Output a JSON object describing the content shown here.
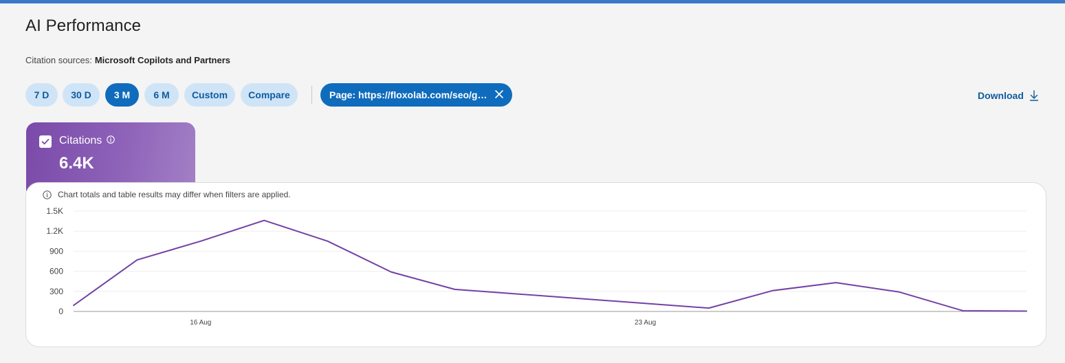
{
  "page": {
    "title": "AI Performance"
  },
  "sources": {
    "label": "Citation sources:",
    "value": "Microsoft Copilots and Partners"
  },
  "ranges": [
    {
      "label": "7 D",
      "active": false
    },
    {
      "label": "30 D",
      "active": false
    },
    {
      "label": "3 M",
      "active": true
    },
    {
      "label": "6 M",
      "active": false
    },
    {
      "label": "Custom",
      "active": false
    },
    {
      "label": "Compare",
      "active": false
    }
  ],
  "filter": {
    "label": "Page: https://floxolab.com/seo/gui..."
  },
  "download": {
    "label": "Download"
  },
  "metric": {
    "label": "Citations",
    "value": "6.4K",
    "checked": true
  },
  "note": {
    "text": "Chart totals and table results may differ when filters are applied."
  },
  "colors": {
    "accent": "#0f6cbd",
    "series": "#7340a6",
    "chip_bg": "#cfe4f7"
  },
  "chart_data": {
    "type": "line",
    "series": [
      {
        "values": [
          {
            "x": "2025-08-14",
            "y": 90
          },
          {
            "x": "2025-08-15",
            "y": 770
          },
          {
            "x": "2025-08-16",
            "y": 1050
          },
          {
            "x": "2025-08-17",
            "y": 1360
          },
          {
            "x": "2025-08-18",
            "y": 1050
          },
          {
            "x": "2025-08-19",
            "y": 590
          },
          {
            "x": "2025-08-20",
            "y": 330
          },
          {
            "x": "2025-08-24",
            "y": 50
          },
          {
            "x": "2025-08-25",
            "y": 310
          },
          {
            "x": "2025-08-26",
            "y": 430
          },
          {
            "x": "2025-08-27",
            "y": 290
          },
          {
            "x": "2025-08-28",
            "y": 10
          },
          {
            "x": "2025-08-29",
            "y": 5
          }
        ]
      }
    ],
    "yticks": [
      "0",
      "300",
      "600",
      "900",
      "1.2K",
      "1.5K"
    ],
    "ylim": [
      0,
      1500
    ],
    "xticks": [
      {
        "x": "2025-08-16",
        "label": "16 Aug"
      },
      {
        "x": "2025-08-23",
        "label": "23 Aug"
      }
    ],
    "xlim": [
      "2025-08-14",
      "2025-08-29"
    ],
    "grid": true
  }
}
